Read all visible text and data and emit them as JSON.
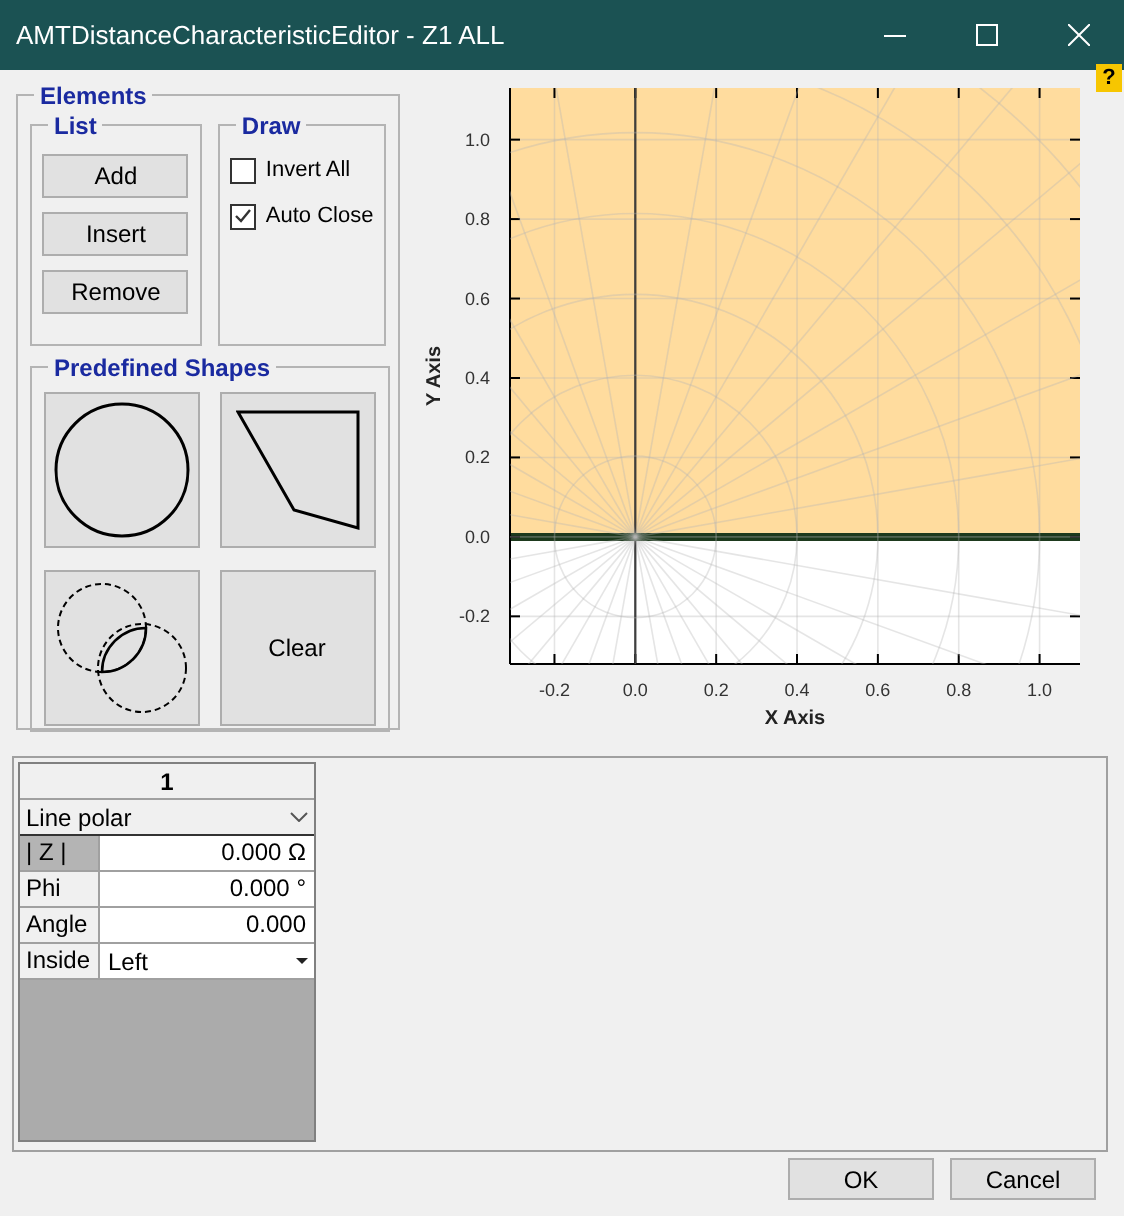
{
  "window": {
    "title": "AMTDistanceCharacteristicEditor - Z1 ALL",
    "help": "?"
  },
  "elements": {
    "title": "Elements",
    "list": {
      "title": "List",
      "buttons": [
        "Add",
        "Insert",
        "Remove"
      ]
    },
    "draw": {
      "title": "Draw",
      "checkboxes": [
        {
          "label": "Invert All",
          "checked": false
        },
        {
          "label": "Auto Close",
          "checked": true
        }
      ]
    },
    "shapes": {
      "title": "Predefined Shapes",
      "buttons": [
        {
          "kind": "circle"
        },
        {
          "kind": "polygon"
        },
        {
          "kind": "lens"
        },
        {
          "kind": "text",
          "label": "Clear"
        }
      ]
    }
  },
  "chart_data": {
    "type": "line",
    "xlabel": "X Axis",
    "ylabel": "Y Axis",
    "x": [
      -0.31,
      1.1
    ],
    "xlim": [
      -0.31,
      1.1
    ],
    "ylim": [
      -0.32,
      1.13
    ],
    "xticks": [
      -0.2,
      {
        "value": 0,
        "label": "0.0"
      },
      0.2,
      0.4,
      0.6,
      0.8,
      {
        "value": 1,
        "label": "1.0"
      }
    ],
    "yticks": [
      -0.2,
      {
        "value": 0,
        "label": "0.0"
      },
      0.2,
      0.4,
      0.6,
      0.8,
      {
        "value": 1,
        "label": "1.0"
      }
    ],
    "grid": true,
    "bands": [
      {
        "axis": "y",
        "from": 0,
        "to": 1.13,
        "color": "#ffdc9e"
      }
    ],
    "series": [
      {
        "color": "#1e3a1e",
        "values": [
          0,
          0
        ]
      }
    ]
  },
  "property_grid": {
    "column": "1",
    "type": "Line polar",
    "rows": [
      {
        "label": "| Z |",
        "value": "0.000",
        "unit": "Ω",
        "selected": true,
        "kind": "number"
      },
      {
        "label": "Phi",
        "value": "0.000",
        "unit": "°",
        "selected": false,
        "kind": "number"
      },
      {
        "label": "Angle",
        "value": "0.000",
        "selected": false,
        "kind": "number"
      },
      {
        "label": "Inside",
        "value": "Left",
        "selected": false,
        "kind": "dropdown"
      }
    ]
  },
  "buttons": [
    "OK",
    "Cancel"
  ]
}
